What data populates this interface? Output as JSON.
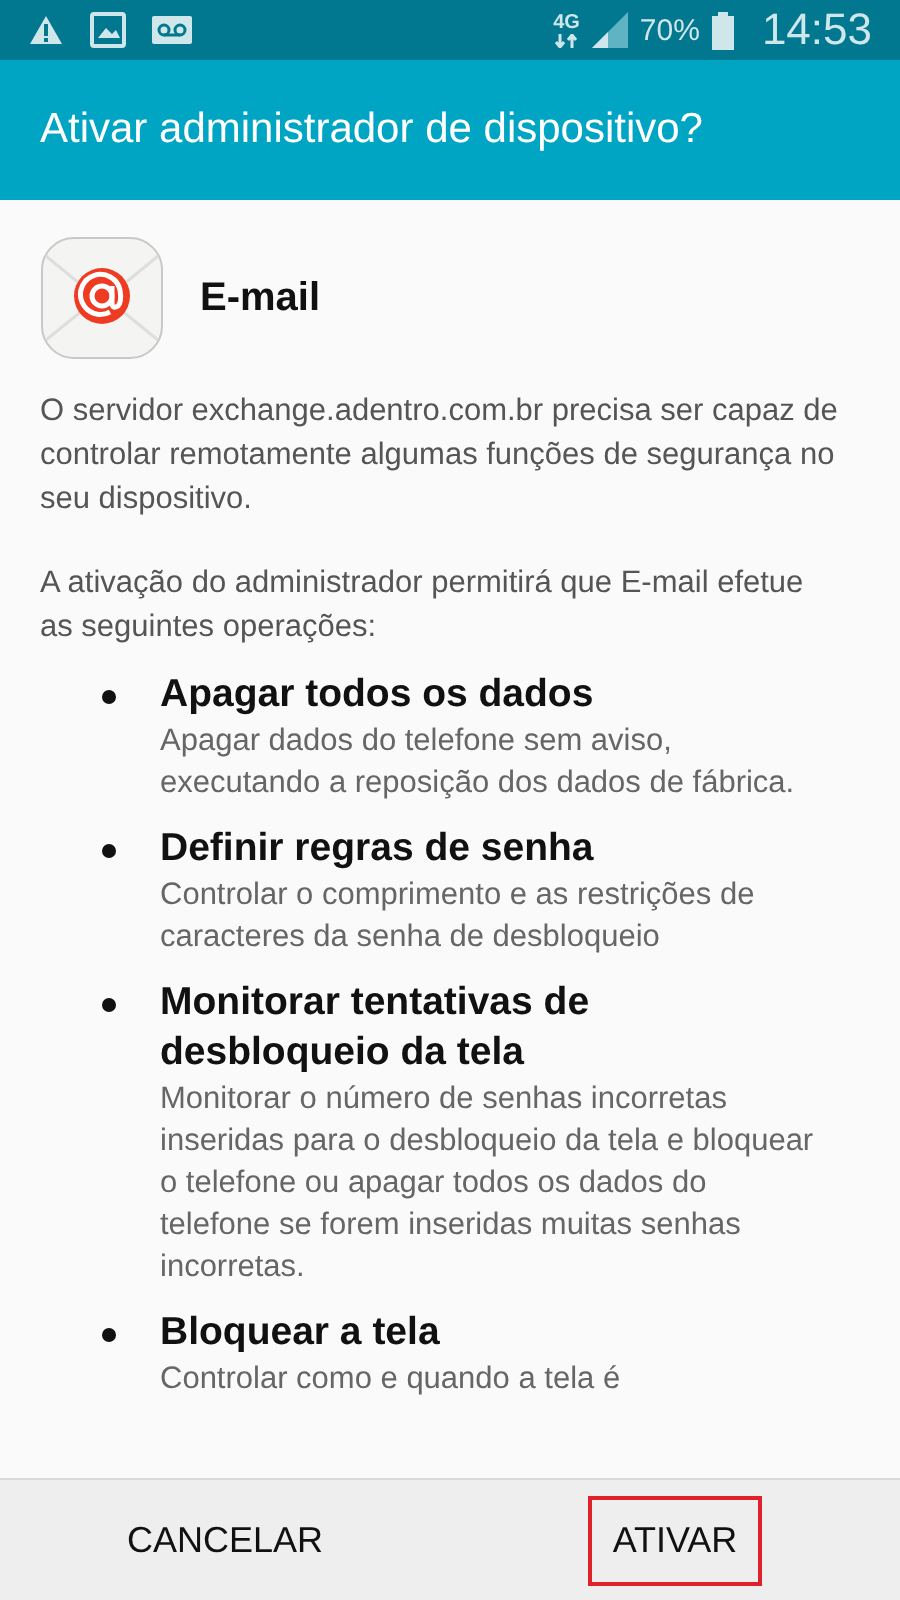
{
  "status_bar": {
    "network": "4G",
    "battery": "70%",
    "time": "14:53"
  },
  "dialog": {
    "title": "Ativar administrador de dispositivo?",
    "app_name": "E-mail",
    "paragraphs": [
      "O servidor exchange.adentro.com.br precisa ser capaz de controlar remotamente algumas funções de segurança no seu dispositivo.",
      "A ativação do administrador permitirá que E-mail efetue as seguintes operações:"
    ],
    "policies": [
      {
        "title": "Apagar todos os dados",
        "description": "Apagar dados do telefone sem aviso, executando a reposição dos dados de fábrica."
      },
      {
        "title": "Definir regras de senha",
        "description": "Controlar o comprimento e as restrições de caracteres da senha de desbloqueio"
      },
      {
        "title": "Monitorar tentativas de desbloqueio da tela",
        "description": "Monitorar o número de senhas incorretas inseridas para o desbloqueio da tela e bloquear o telefone ou apagar todos os dados do telefone se forem inseridas muitas senhas incorretas."
      },
      {
        "title": "Bloquear a tela",
        "description": "Controlar como e quando a tela é"
      }
    ],
    "buttons": [
      {
        "label": "CANCELAR",
        "highlighted": false
      },
      {
        "label": "ATIVAR",
        "highlighted": true
      }
    ]
  }
}
